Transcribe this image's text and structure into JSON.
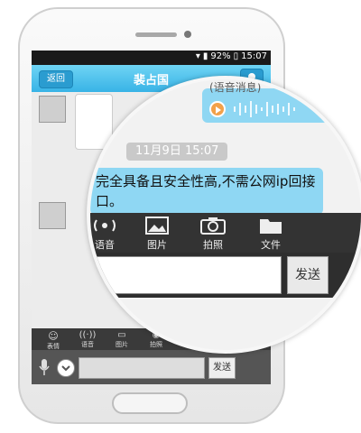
{
  "status": {
    "battery": "92%",
    "time": "15:07"
  },
  "titlebar": {
    "back_label": "返回",
    "title": "裴占国"
  },
  "voice_message": {
    "label": "(语音消息)"
  },
  "chat": {
    "timestamp": "11月9日 15:07",
    "message": "完全具备且安全性高,不需公网ip回接口。"
  },
  "toolbar_small": {
    "items": [
      "表情",
      "语音",
      "图片",
      "拍照"
    ]
  },
  "toolbar": {
    "items": [
      "语音",
      "图片",
      "拍照",
      "文件"
    ]
  },
  "input": {
    "send_label": "发送"
  },
  "icons": {
    "back": "back-arrow-icon",
    "user": "user-icon",
    "play": "play-icon",
    "voice": "voice-icon",
    "image": "image-icon",
    "camera": "camera-icon",
    "file": "folder-icon",
    "mic": "microphone-icon"
  },
  "colors": {
    "title_bar": "#38b3e6",
    "bubble": "#8fd7f3",
    "toolbar": "#333333",
    "play_button": "#f2a14a"
  }
}
